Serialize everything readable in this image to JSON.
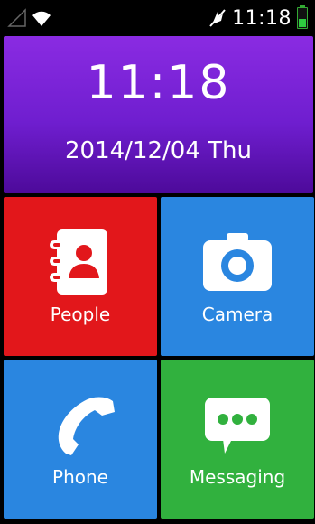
{
  "status_bar": {
    "time": "11:18",
    "icons": [
      "signal-icon",
      "wifi-icon",
      "mute-icon",
      "battery-icon"
    ]
  },
  "clock_widget": {
    "time": "11:18",
    "date": "2014/12/04 Thu",
    "color": "#7b22d6"
  },
  "tiles": [
    {
      "label": "People",
      "icon": "contacts-icon",
      "color": "#e2171b"
    },
    {
      "label": "Camera",
      "icon": "camera-icon",
      "color": "#2a86e0"
    },
    {
      "label": "Phone",
      "icon": "phone-icon",
      "color": "#2a86e0"
    },
    {
      "label": "Messaging",
      "icon": "chat-bubble-icon",
      "color": "#31b13e"
    }
  ]
}
